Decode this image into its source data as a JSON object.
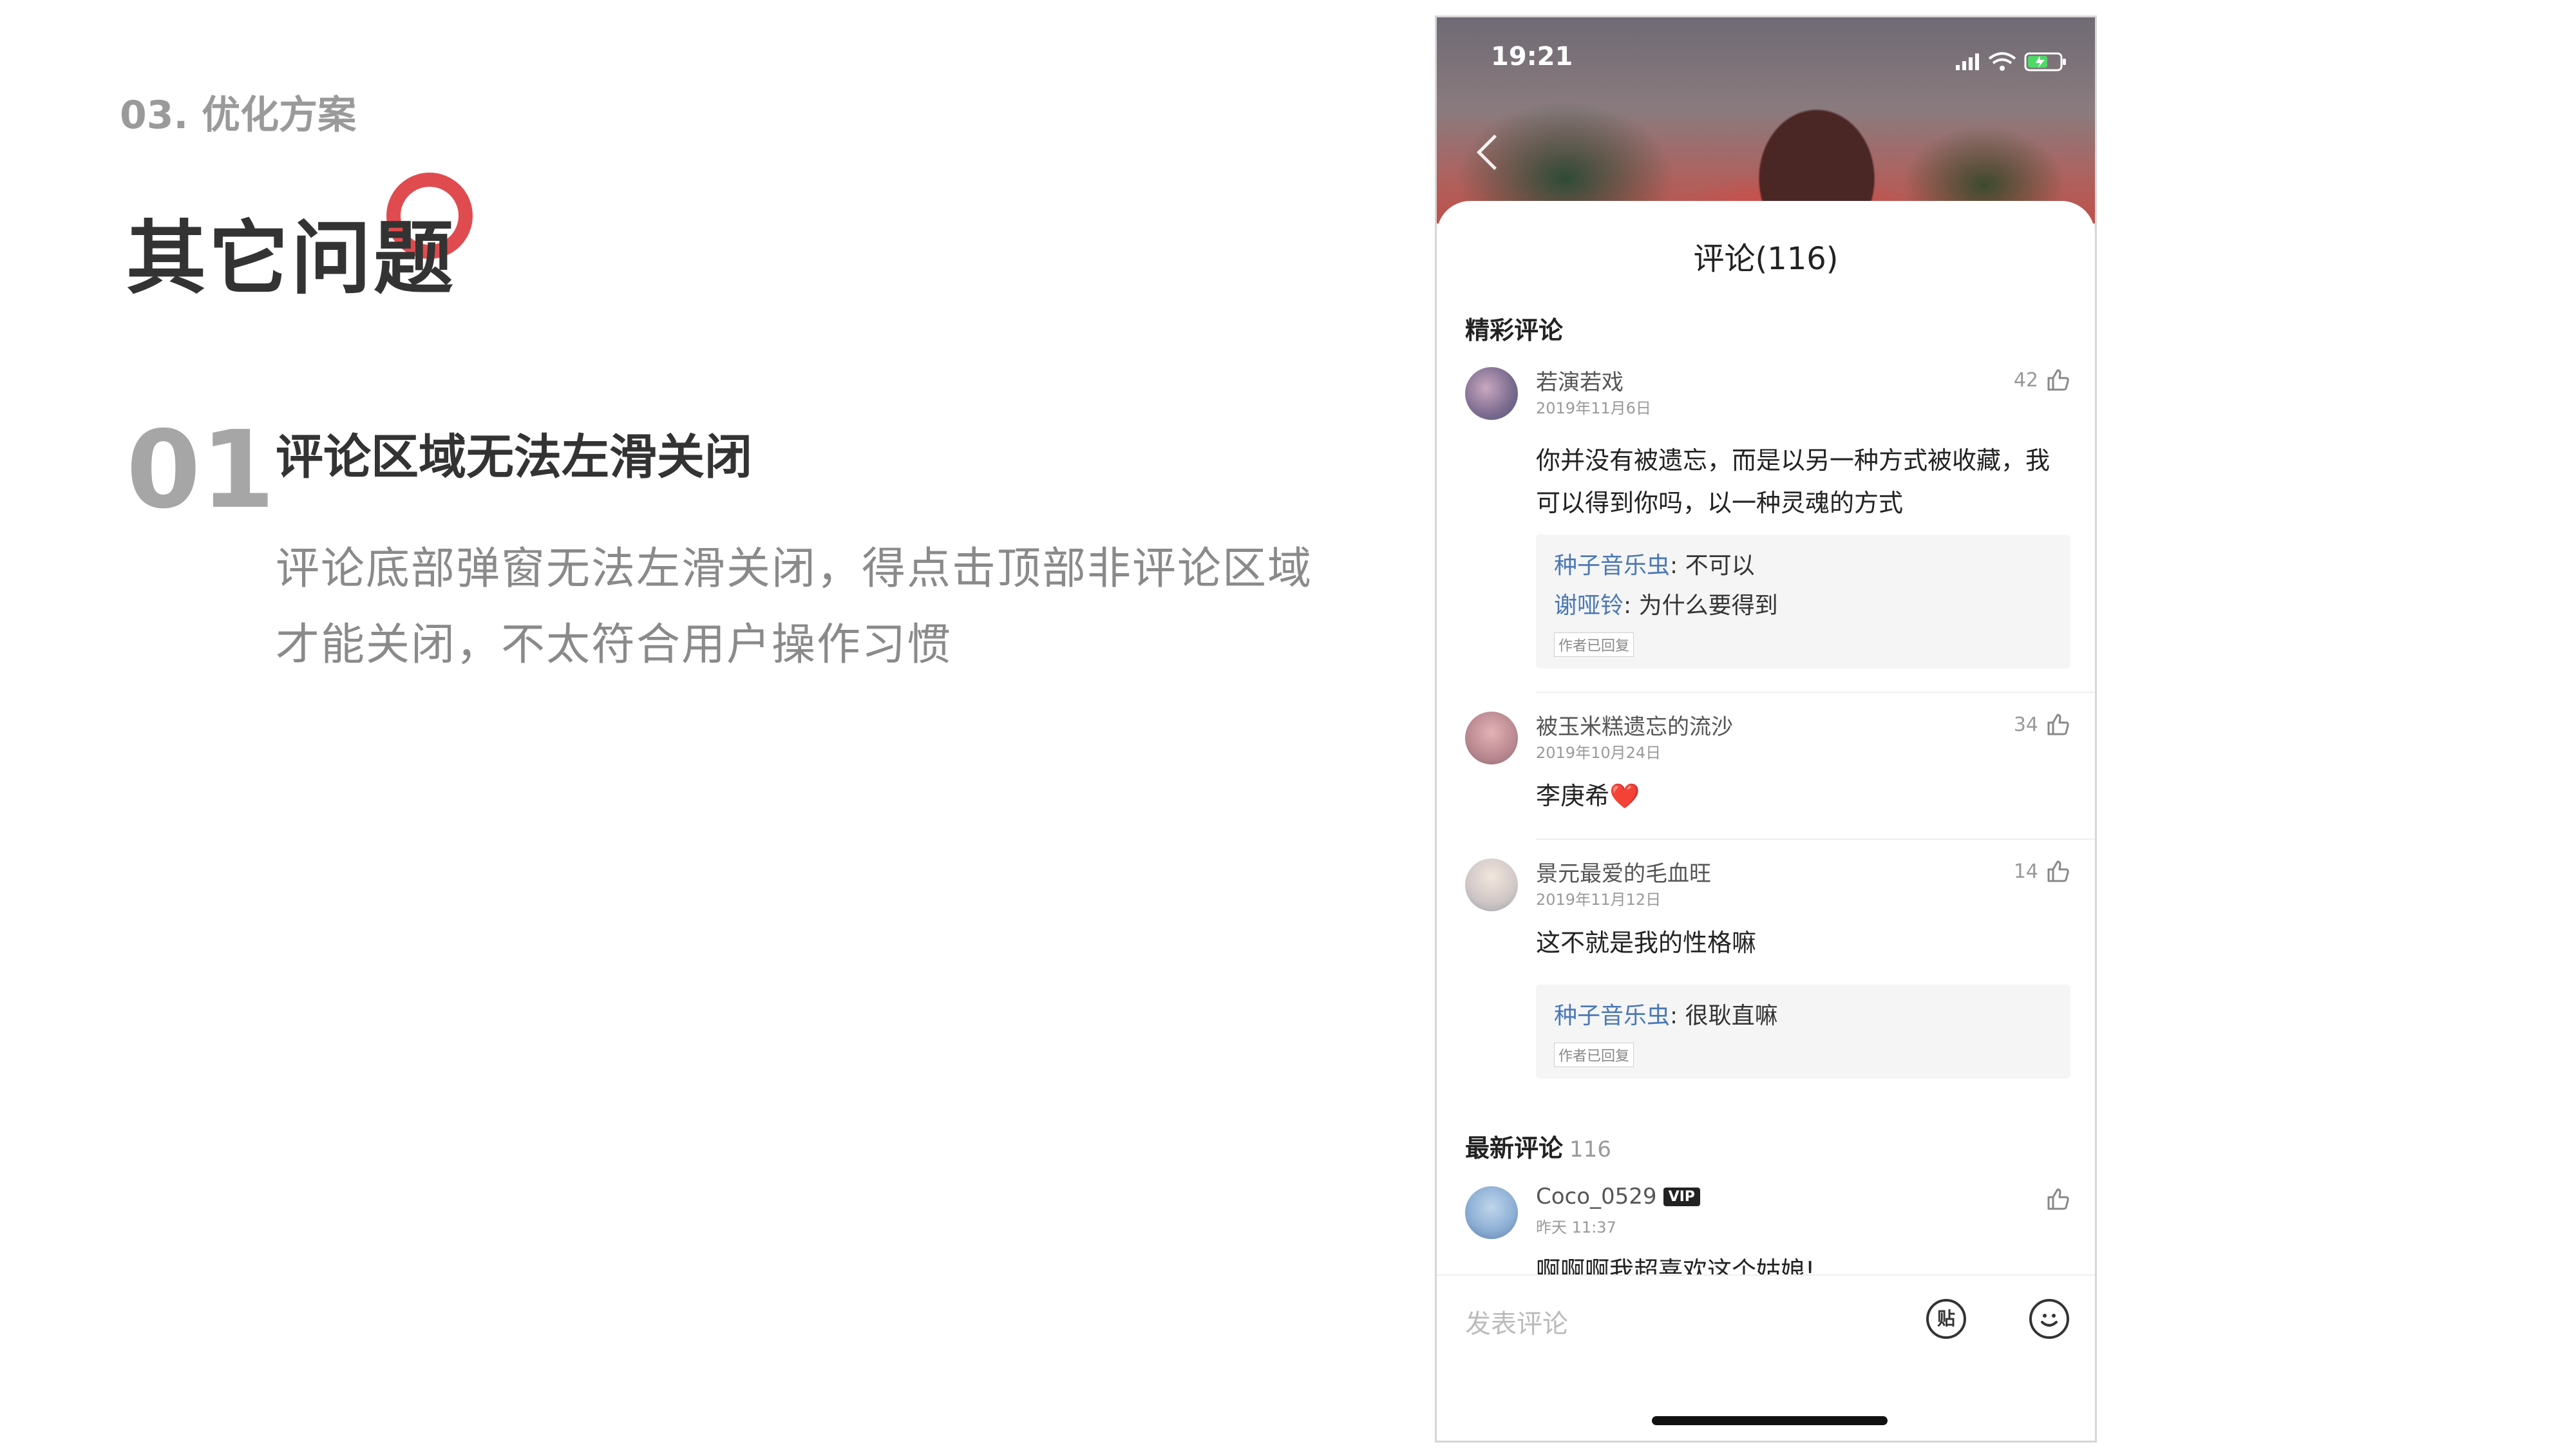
{
  "slide": {
    "section_label": "03. 优化方案",
    "title": "其它问题",
    "issue_number": "01",
    "issue_title": "评论区域无法左滑关闭",
    "issue_desc_line1": "评论底部弹窗无法左滑关闭，得点击顶部非评论区域",
    "issue_desc_line2": "才能关闭，不太符合用户操作习惯",
    "accent_color": "#e04b4f"
  },
  "phone": {
    "status_time": "19:21",
    "sheet_title": "评论(116)",
    "featured_label": "精彩评论",
    "latest_label": "最新评论",
    "latest_count": "116",
    "featured": [
      {
        "name": "若演若戏",
        "date": "2019年11月6日",
        "likes": "42",
        "text_line1": "你并没有被遗忘，而是以另一种方式被收藏，我",
        "text_line2": "可以得到你吗，以一种灵魂的方式",
        "replies": [
          {
            "name": "种子音乐虫",
            "text": ": 不可以"
          },
          {
            "name": "谢哑铃",
            "text": ": 为什么要得到"
          }
        ],
        "author_tag": "作者已回复"
      },
      {
        "name": "被玉米糕遗忘的流沙",
        "date": "2019年10月24日",
        "likes": "34",
        "text": "李庚希",
        "emoji": "❤️"
      },
      {
        "name": "景元最爱的毛血旺",
        "date": "2019年11月12日",
        "likes": "14",
        "text": "这不就是我的性格嘛",
        "replies": [
          {
            "name": "种子音乐虫",
            "text": ": 很耿直嘛"
          }
        ],
        "author_tag": "作者已回复"
      }
    ],
    "latest": [
      {
        "name": "Coco_0529",
        "badge": "VIP",
        "date": "昨天 11:37",
        "text": "啊啊啊我超喜欢这个姑娘!"
      }
    ],
    "input_placeholder": "发表评论",
    "tie_icon_label": "贴",
    "reply_name_color": "#4a78b5"
  }
}
